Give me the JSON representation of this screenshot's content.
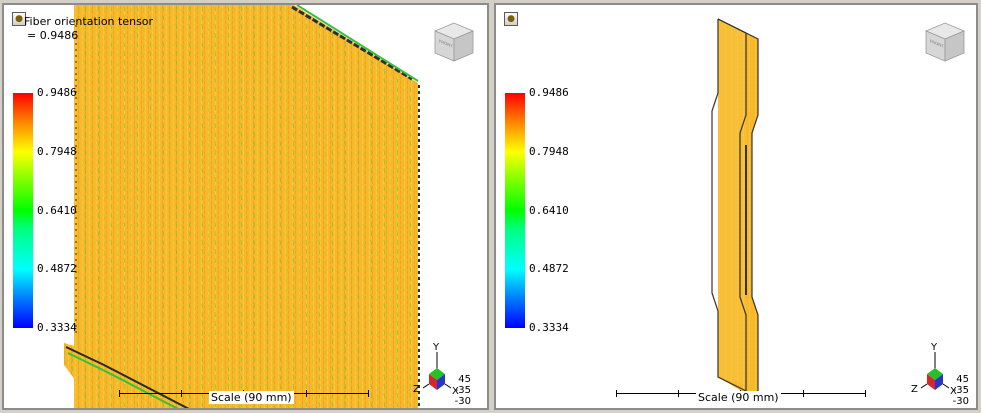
{
  "result": {
    "title": "Fiber orientation tensor",
    "value": "= 0.9486"
  },
  "legend": {
    "values": [
      "0.9486",
      "0.7948",
      "0.6410",
      "0.4872",
      "0.3334"
    ],
    "min": 0.3334,
    "max": 0.9486,
    "colors": [
      "#ff0000",
      "#ffff00",
      "#00ff00",
      "#00ffff",
      "#0000ff"
    ]
  },
  "scale": {
    "label": "Scale (90 mm)"
  },
  "axes": {
    "y": "Y",
    "z": "Z",
    "x": "X"
  },
  "orientation": {
    "values": [
      "45",
      "-35",
      "-30"
    ]
  },
  "viewcube": {
    "face_label": "FRONT"
  },
  "colors": {
    "model_fill": "#f9b82a",
    "model_fill_light": "#f7d04a",
    "model_edge": "#333333",
    "green_streak": "#3fcf3f",
    "background": "#ffffff",
    "frame": "#d4d0c8"
  }
}
